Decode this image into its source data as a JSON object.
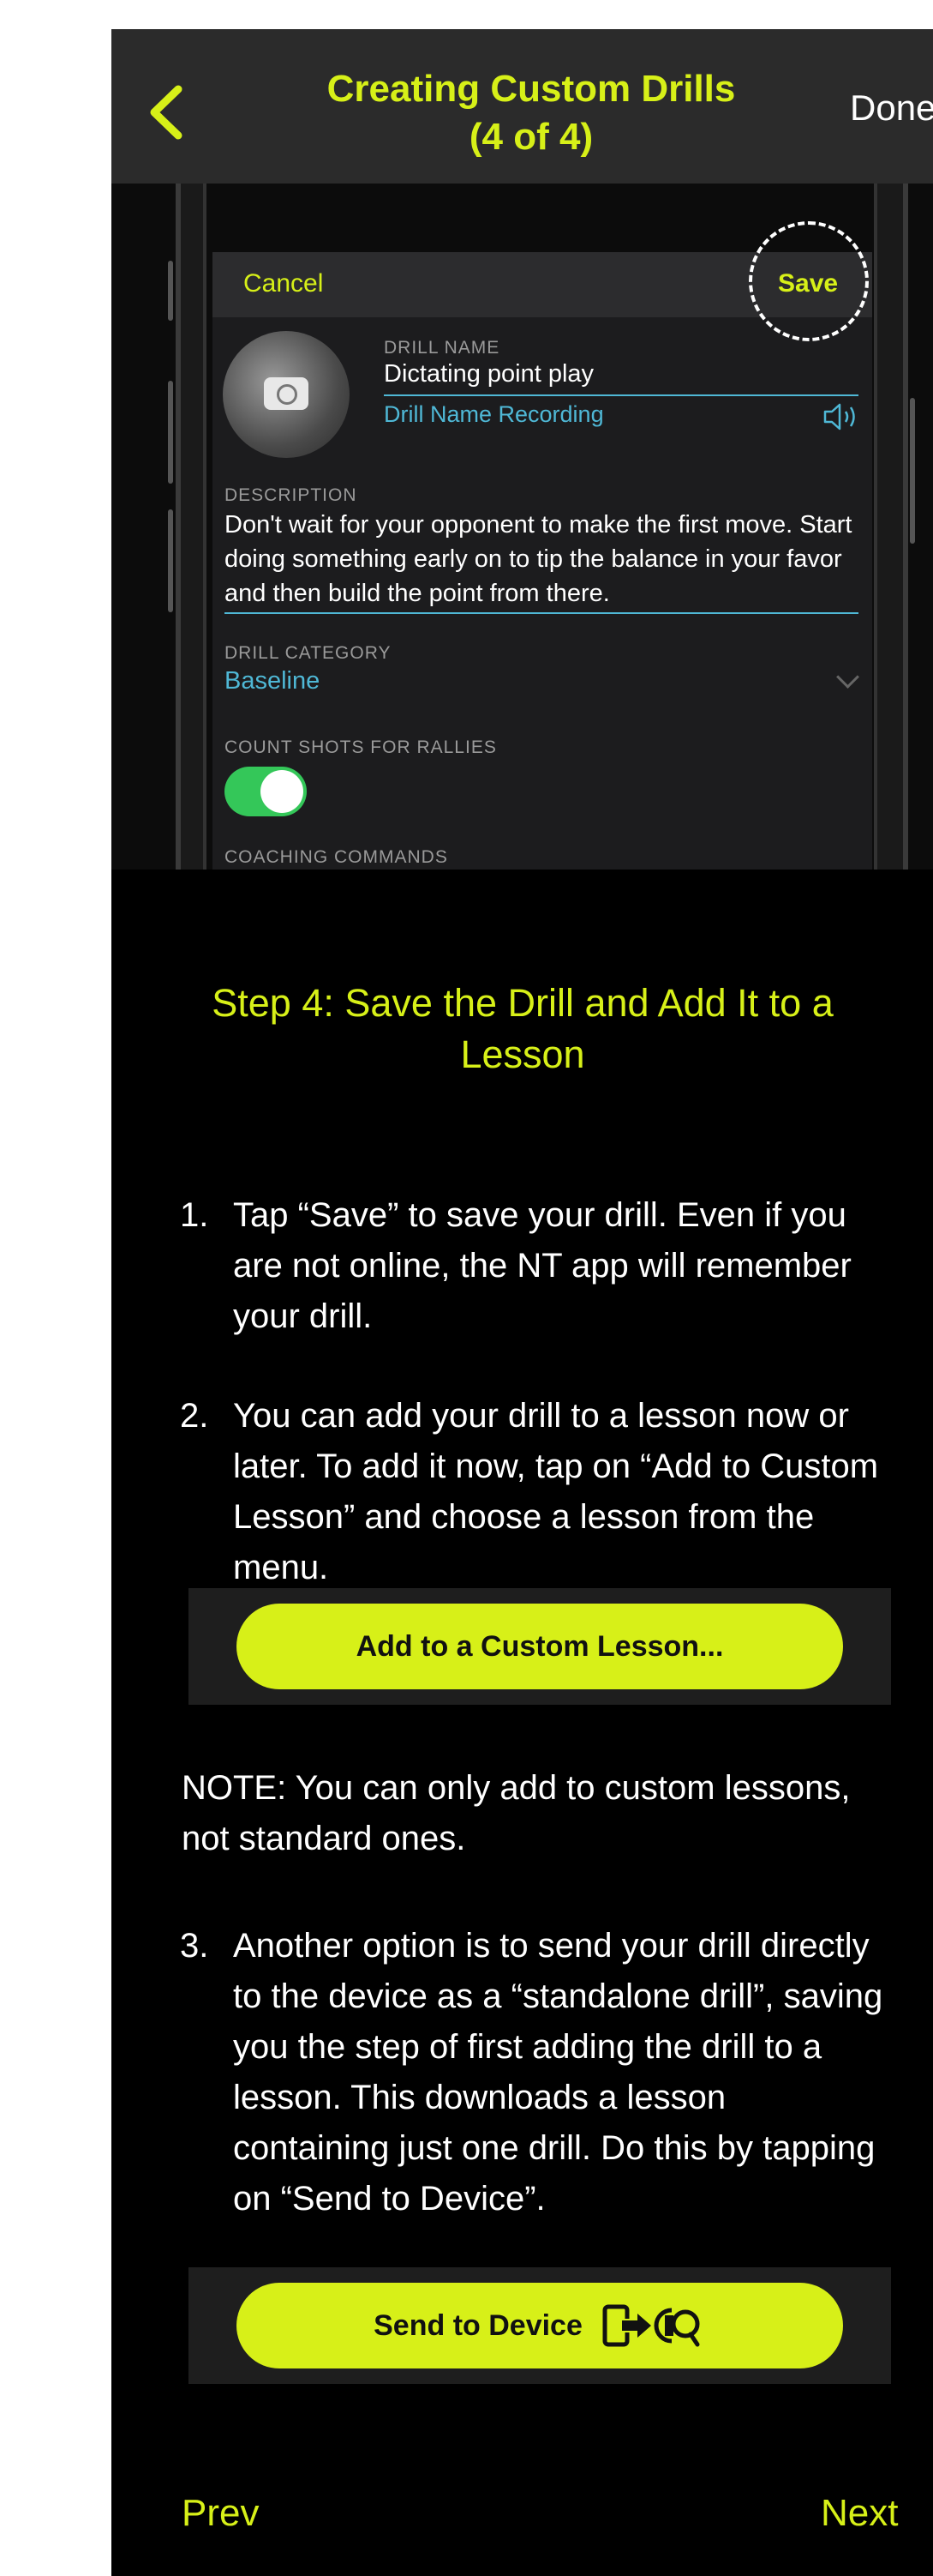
{
  "header": {
    "title_line1": "Creating Custom Drills",
    "title_line2": "(4 of 4)",
    "done_label": "Done"
  },
  "screenshot": {
    "cancel_label": "Cancel",
    "save_label": "Save",
    "drill_name_label": "DRILL NAME",
    "drill_name_value": "Dictating point play",
    "drill_name_recording": "Drill Name Recording",
    "description_label": "DESCRIPTION",
    "description_value": "Don't wait for your opponent to make the first move. Start doing something early on to tip the balance in your favor and then build the point from there.",
    "category_label": "DRILL CATEGORY",
    "category_value": "Baseline",
    "count_shots_label": "COUNT SHOTS FOR RALLIES",
    "count_shots_on": true,
    "coaching_label": "COACHING COMMANDS"
  },
  "step": {
    "title": "Step 4: Save the Drill and Add It to a Lesson",
    "items": [
      {
        "num": "1.",
        "text": "Tap “Save” to save your drill. Even if you are not online, the NT app will remember your drill."
      },
      {
        "num": "2.",
        "text": "You can add your drill to a lesson now or later. To add it now, tap on “Add to Custom Lesson” and choose a lesson from the menu."
      },
      {
        "num": "3.",
        "text": "Another option is to send your drill directly to the device as a “standalone drill”, saving you the step of first adding the drill to a lesson. This downloads a lesson containing just one drill. Do this by tapping on “Send to Device”."
      }
    ],
    "add_button_label": "Add to a Custom Lesson...",
    "note": "NOTE:  You can only add to custom lessons, not standard ones.",
    "send_button_label": "Send to Device"
  },
  "nav": {
    "prev_label": "Prev",
    "next_label": "Next"
  },
  "colors": {
    "accent": "#d7f018",
    "background": "#000000",
    "header_bg": "#2b2b2b",
    "link_blue": "#4fb8d6",
    "toggle_on": "#34c759"
  }
}
